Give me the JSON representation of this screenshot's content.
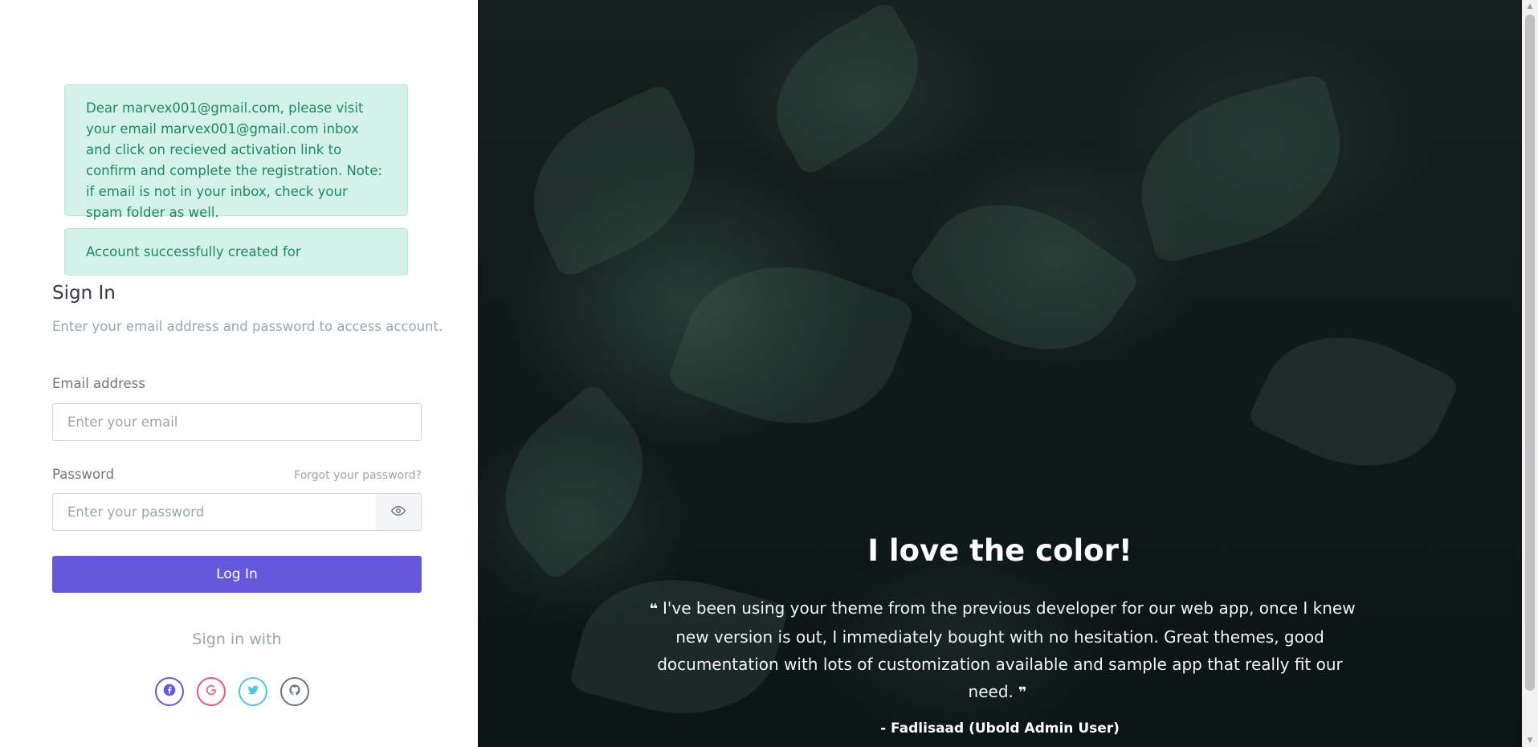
{
  "alerts": {
    "activation": "Dear marvex001@gmail.com, please visit your email marvex001@gmail.com inbox and click on recieved activation link to confirm and complete the registration. Note: if email is not in your inbox, check your spam folder as well.",
    "created": "Account successfully created for"
  },
  "signin": {
    "title": "Sign In",
    "subtitle": "Enter your email address and password to access account."
  },
  "form": {
    "email_label": "Email address",
    "email_placeholder": "Enter your email",
    "email_value": "",
    "password_label": "Password",
    "forgot_link": "Forgot your password?",
    "password_placeholder": "Enter your password",
    "password_value": "",
    "login_button": "Log In"
  },
  "social": {
    "heading": "Sign in with",
    "buttons": [
      {
        "icon": "facebook-icon",
        "glyph": "f",
        "color": "#6658dd"
      },
      {
        "icon": "google-icon",
        "glyph": "G",
        "color": "#f1556c"
      },
      {
        "icon": "twitter-icon",
        "glyph": "t",
        "color": "#4fc6e1"
      },
      {
        "icon": "github-icon",
        "glyph": "◉",
        "color": "#6c757d"
      }
    ]
  },
  "testimonial": {
    "title": "I love the color!",
    "quote": "I've been using your theme from the previous developer for our web app, once I knew new version is out, I immediately bought with no hesitation. Great themes, good documentation with lots of customization available and sample app that really fit our need.",
    "open_mark": "❝",
    "close_mark": "❞",
    "author": "- Fadlisaad (Ubold Admin User)"
  },
  "colors": {
    "primary": "#6658dd",
    "alert_bg": "#d5f2ea",
    "alert_text": "#1a8a62"
  }
}
